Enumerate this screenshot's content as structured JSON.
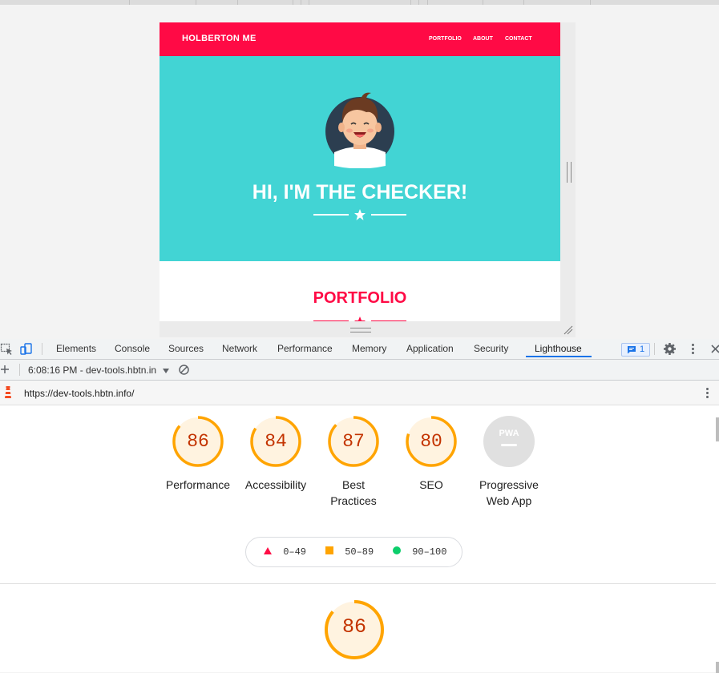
{
  "site": {
    "brand": "HOLBERTON ME",
    "nav": [
      "PORTFOLIO",
      "ABOUT",
      "CONTACT"
    ],
    "hero_title": "HI, I'M THE CHECKER!",
    "section_title": "PORTFOLIO"
  },
  "devtools": {
    "tabs": [
      "Elements",
      "Console",
      "Sources",
      "Network",
      "Performance",
      "Memory",
      "Application",
      "Security",
      "Lighthouse"
    ],
    "active_tab": "Lighthouse",
    "issues_count": "1",
    "report_label": "6:08:16 PM - dev-tools.hbtn.in",
    "url": "https://dev-tools.hbtn.info/"
  },
  "lighthouse": {
    "categories": [
      {
        "label": "Performance",
        "score": "86",
        "fraction": 0.86
      },
      {
        "label": "Accessibility",
        "score": "84",
        "fraction": 0.84
      },
      {
        "label": "Best Practices",
        "score": "87",
        "fraction": 0.87
      },
      {
        "label": "SEO",
        "score": "80",
        "fraction": 0.8
      },
      {
        "label": "Progressive Web App",
        "score": "PWA"
      }
    ],
    "legend": [
      "0–49",
      "50–89",
      "90–100"
    ],
    "detail_score": "86",
    "detail_fraction": 0.86
  },
  "colors": {
    "nav": "#ff0a45",
    "hero": "#42d4d4",
    "average": "#ffa400",
    "fail": "#ff0d45",
    "pass": "#0cce6b",
    "accent": "#1a73e8"
  }
}
